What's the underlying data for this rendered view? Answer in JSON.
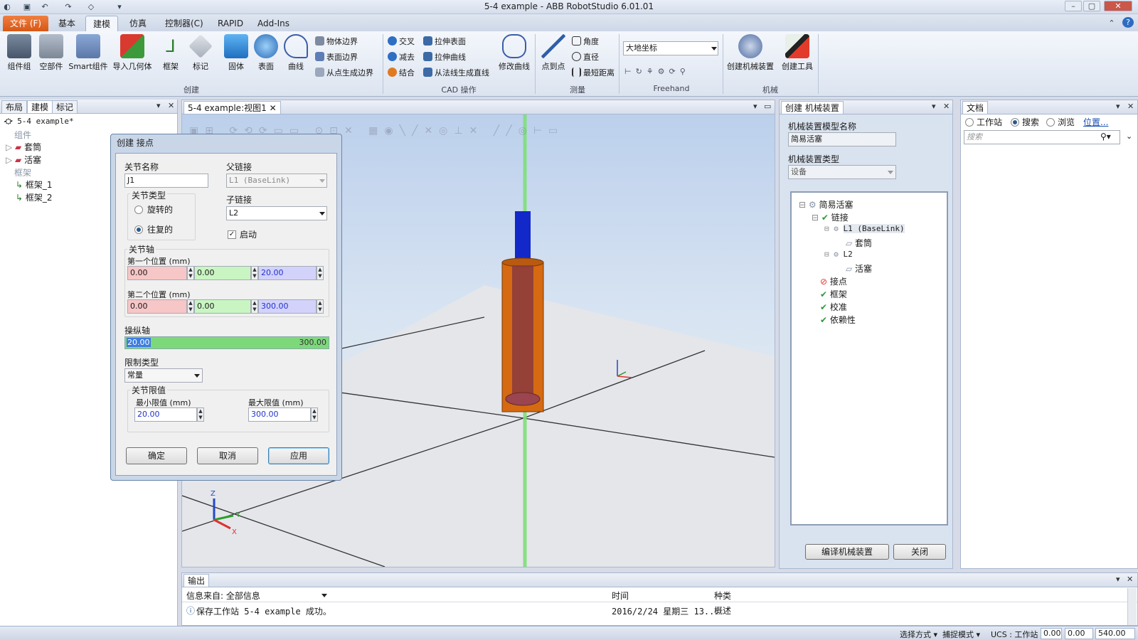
{
  "window": {
    "title": "5-4 example - ABB RobotStudio 6.01.01"
  },
  "ribbon": {
    "tabs": [
      "文件 (F)",
      "基本",
      "建模",
      "仿真",
      "控制器(C)",
      "RAPID",
      "Add-Ins"
    ],
    "create": {
      "group_label": "创建",
      "buttons": [
        "组件组",
        "空部件",
        "Smart组件",
        "导入几何体",
        "框架",
        "标记",
        "固体",
        "表面",
        "曲线"
      ],
      "small": [
        "物体边界",
        "表面边界",
        "从点生成边界"
      ]
    },
    "cad": {
      "group_label": "CAD 操作",
      "small": [
        "交叉",
        "减去",
        "结合",
        "拉伸表面",
        "拉伸曲线",
        "从法线生成直线"
      ],
      "modify_curve": "修改曲线"
    },
    "measure": {
      "group_label": "测量",
      "point_to_point": "点到点",
      "small": [
        "角度",
        "直径",
        "最短距离"
      ]
    },
    "freehand": {
      "group_label": "Freehand",
      "coord_system": "大地坐标"
    },
    "mechanism": {
      "group_label": "机械",
      "create_mechanism": "创建机械装置",
      "create_tool": "创建工具"
    }
  },
  "left_panel": {
    "tabs": [
      "布局",
      "建模",
      "标记"
    ],
    "station": "5-4 example*",
    "components_label": "组件",
    "components": [
      "套筒",
      "活塞"
    ],
    "frames_label": "框架",
    "frames": [
      "框架_1",
      "框架_2"
    ]
  },
  "viewport": {
    "tab": "5-4 example:视图1"
  },
  "dialog": {
    "title": "创建 接点",
    "joint_name_label": "关节名称",
    "joint_name": "J1",
    "parent_link_label": "父链接",
    "parent_link": "L1 (BaseLink)",
    "child_link_label": "子链接",
    "child_link": "L2",
    "joint_type_label": "关节类型",
    "rotational": "旋转的",
    "prismatic": "往复的",
    "enable_label": "启动",
    "axis_label": "关节轴",
    "first_pos_label": "第一个位置 (mm)",
    "first_pos": [
      "0.00",
      "0.00",
      "20.00"
    ],
    "second_pos_label": "第二个位置 (mm)",
    "second_pos": [
      "0.00",
      "0.00",
      "300.00"
    ],
    "jog_label": "操纵轴",
    "jog_value": "20.00",
    "jog_max": "300.00",
    "jog_fraction": 0.0,
    "limit_type_label": "限制类型",
    "limit_type": "常量",
    "limits_label": "关节限值",
    "min_label": "最小限值 (mm)",
    "min_value": "20.00",
    "max_label": "最大限值 (mm)",
    "max_value": "300.00",
    "ok": "确定",
    "cancel": "取消",
    "apply": "应用"
  },
  "mech_panel": {
    "title": "创建 机械装置",
    "model_name_label": "机械装置模型名称",
    "model_name": "简易活塞",
    "type_label": "机械装置类型",
    "type": "设备",
    "tree": {
      "root": "简易活塞",
      "links": "链接",
      "l1": "L1 (BaseLink)",
      "l1_child": "套筒",
      "l2": "L2",
      "l2_child": "活塞",
      "joints": "接点",
      "frames": "框架",
      "calibration": "校准",
      "dependency": "依赖性"
    },
    "compile": "编译机械装置",
    "close": "关闭"
  },
  "doc_panel": {
    "title": "文档",
    "station": "工作站",
    "search": "搜索",
    "browse": "浏览",
    "location": "位置...",
    "search_placeholder": "搜索"
  },
  "output": {
    "title": "输出",
    "source_label": "信息来自: 全部信息",
    "col_time": "时间",
    "col_type": "种类",
    "row_message": "保存工作站 5-4 example 成功。",
    "row_time": "2016/2/24 星期三 13...",
    "row_type": "概述"
  },
  "statusbar": {
    "select_mode": "选择方式 ▾",
    "snap_mode": "捕捉模式 ▾",
    "ucs": "UCS : 工作站",
    "coords": [
      "0.00",
      "0.00",
      "540.00"
    ]
  },
  "colors": {
    "accent": "#d65715",
    "x_field": "#f7c6c6",
    "y_field": "#c9f5c2",
    "z_field": "#d2d2fb",
    "jog_fill": "#7dd87a"
  }
}
